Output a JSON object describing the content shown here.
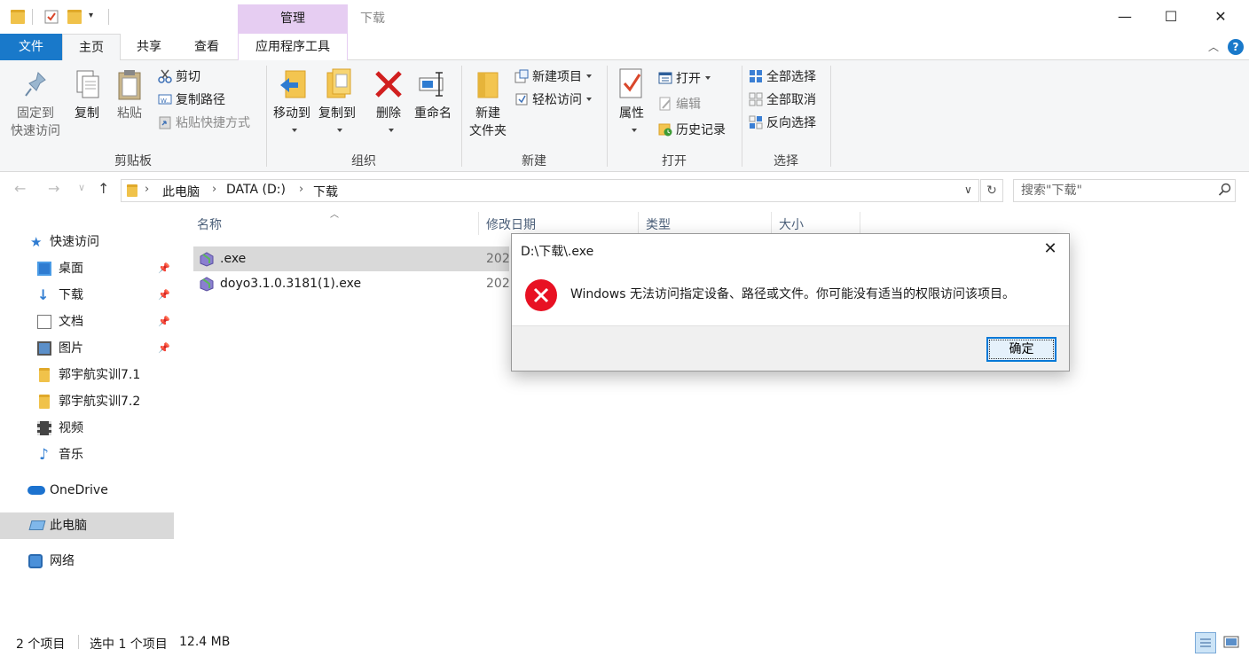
{
  "titlebar": {
    "context_tab": "管理",
    "title": "下载",
    "minimize": "—",
    "maximize": "☐",
    "close": "✕"
  },
  "tabs": {
    "file": "文件",
    "home": "主页",
    "share": "共享",
    "view": "查看",
    "app_tools": "应用程序工具",
    "help_icon": "?"
  },
  "ribbon": {
    "clipboard": {
      "pin_line1": "固定到",
      "pin_line2": "快速访问",
      "copy": "复制",
      "paste": "粘贴",
      "cut": "剪切",
      "copy_path": "复制路径",
      "paste_shortcut": "粘贴快捷方式",
      "label": "剪贴板"
    },
    "organize": {
      "move_to": "移动到",
      "copy_to": "复制到",
      "delete": "删除",
      "rename": "重命名",
      "label": "组织"
    },
    "new": {
      "new_folder_line1": "新建",
      "new_folder_line2": "文件夹",
      "new_item": "新建项目",
      "easy_access": "轻松访问",
      "label": "新建"
    },
    "open": {
      "properties": "属性",
      "open": "打开",
      "edit": "编辑",
      "history": "历史记录",
      "label": "打开"
    },
    "select": {
      "select_all": "全部选择",
      "select_none": "全部取消",
      "invert": "反向选择",
      "label": "选择"
    }
  },
  "address": {
    "crumbs": [
      "此电脑",
      "DATA (D:)",
      "下载"
    ],
    "search_placeholder": "搜索\"下载\""
  },
  "navpane": {
    "quick_access": "快速访问",
    "items": [
      "桌面",
      "下载",
      "文档",
      "图片",
      "郭宇航实训7.1",
      "郭宇航实训7.2",
      "视频",
      "音乐"
    ],
    "onedrive": "OneDrive",
    "this_pc": "此电脑",
    "network": "网络"
  },
  "filelist": {
    "columns": [
      "名称",
      "修改日期",
      "类型",
      "大小"
    ],
    "files": [
      {
        "name": ".exe",
        "date": "202"
      },
      {
        "name": "doyo3.1.0.3181(1).exe",
        "date": "202"
      }
    ]
  },
  "statusbar": {
    "count": "2 个项目",
    "selection": "选中 1 个项目",
    "size": "12.4 MB"
  },
  "dialog": {
    "title": "D:\\下载\\.exe",
    "message": "Windows 无法访问指定设备、路径或文件。你可能没有适当的权限访问该项目。",
    "ok": "确定",
    "close": "✕"
  },
  "colors": {
    "file_tab": "#1979ca",
    "context_tab": "#e6cdf2",
    "error_red": "#e81123",
    "selection": "#d9d9d9"
  }
}
